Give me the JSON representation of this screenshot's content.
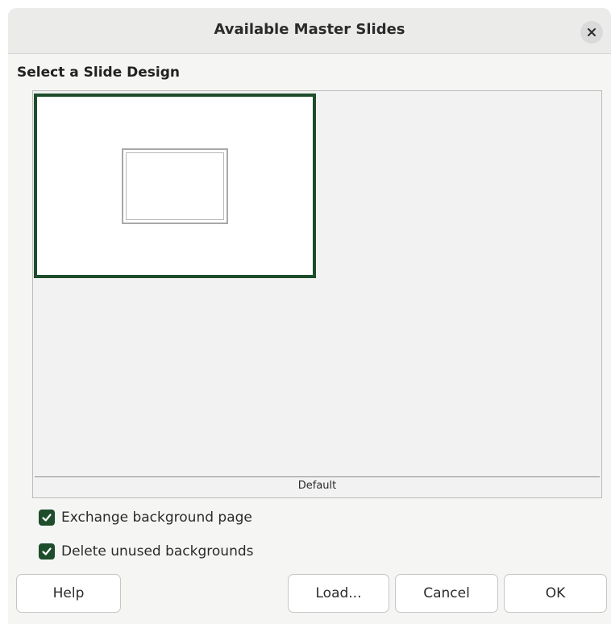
{
  "dialog": {
    "title": "Available Master Slides",
    "close_icon": "close-icon"
  },
  "design_section": {
    "label": "Select a Slide Design",
    "selected_slide": "Default",
    "footer_label": "Default",
    "accent_color": "#1e4d2b"
  },
  "options": {
    "exchange_background": {
      "label": "Exchange background page",
      "checked": true
    },
    "delete_unused": {
      "label": "Delete unused backgrounds",
      "checked": true
    }
  },
  "buttons": {
    "help": "Help",
    "load": "Load...",
    "cancel": "Cancel",
    "ok": "OK"
  }
}
